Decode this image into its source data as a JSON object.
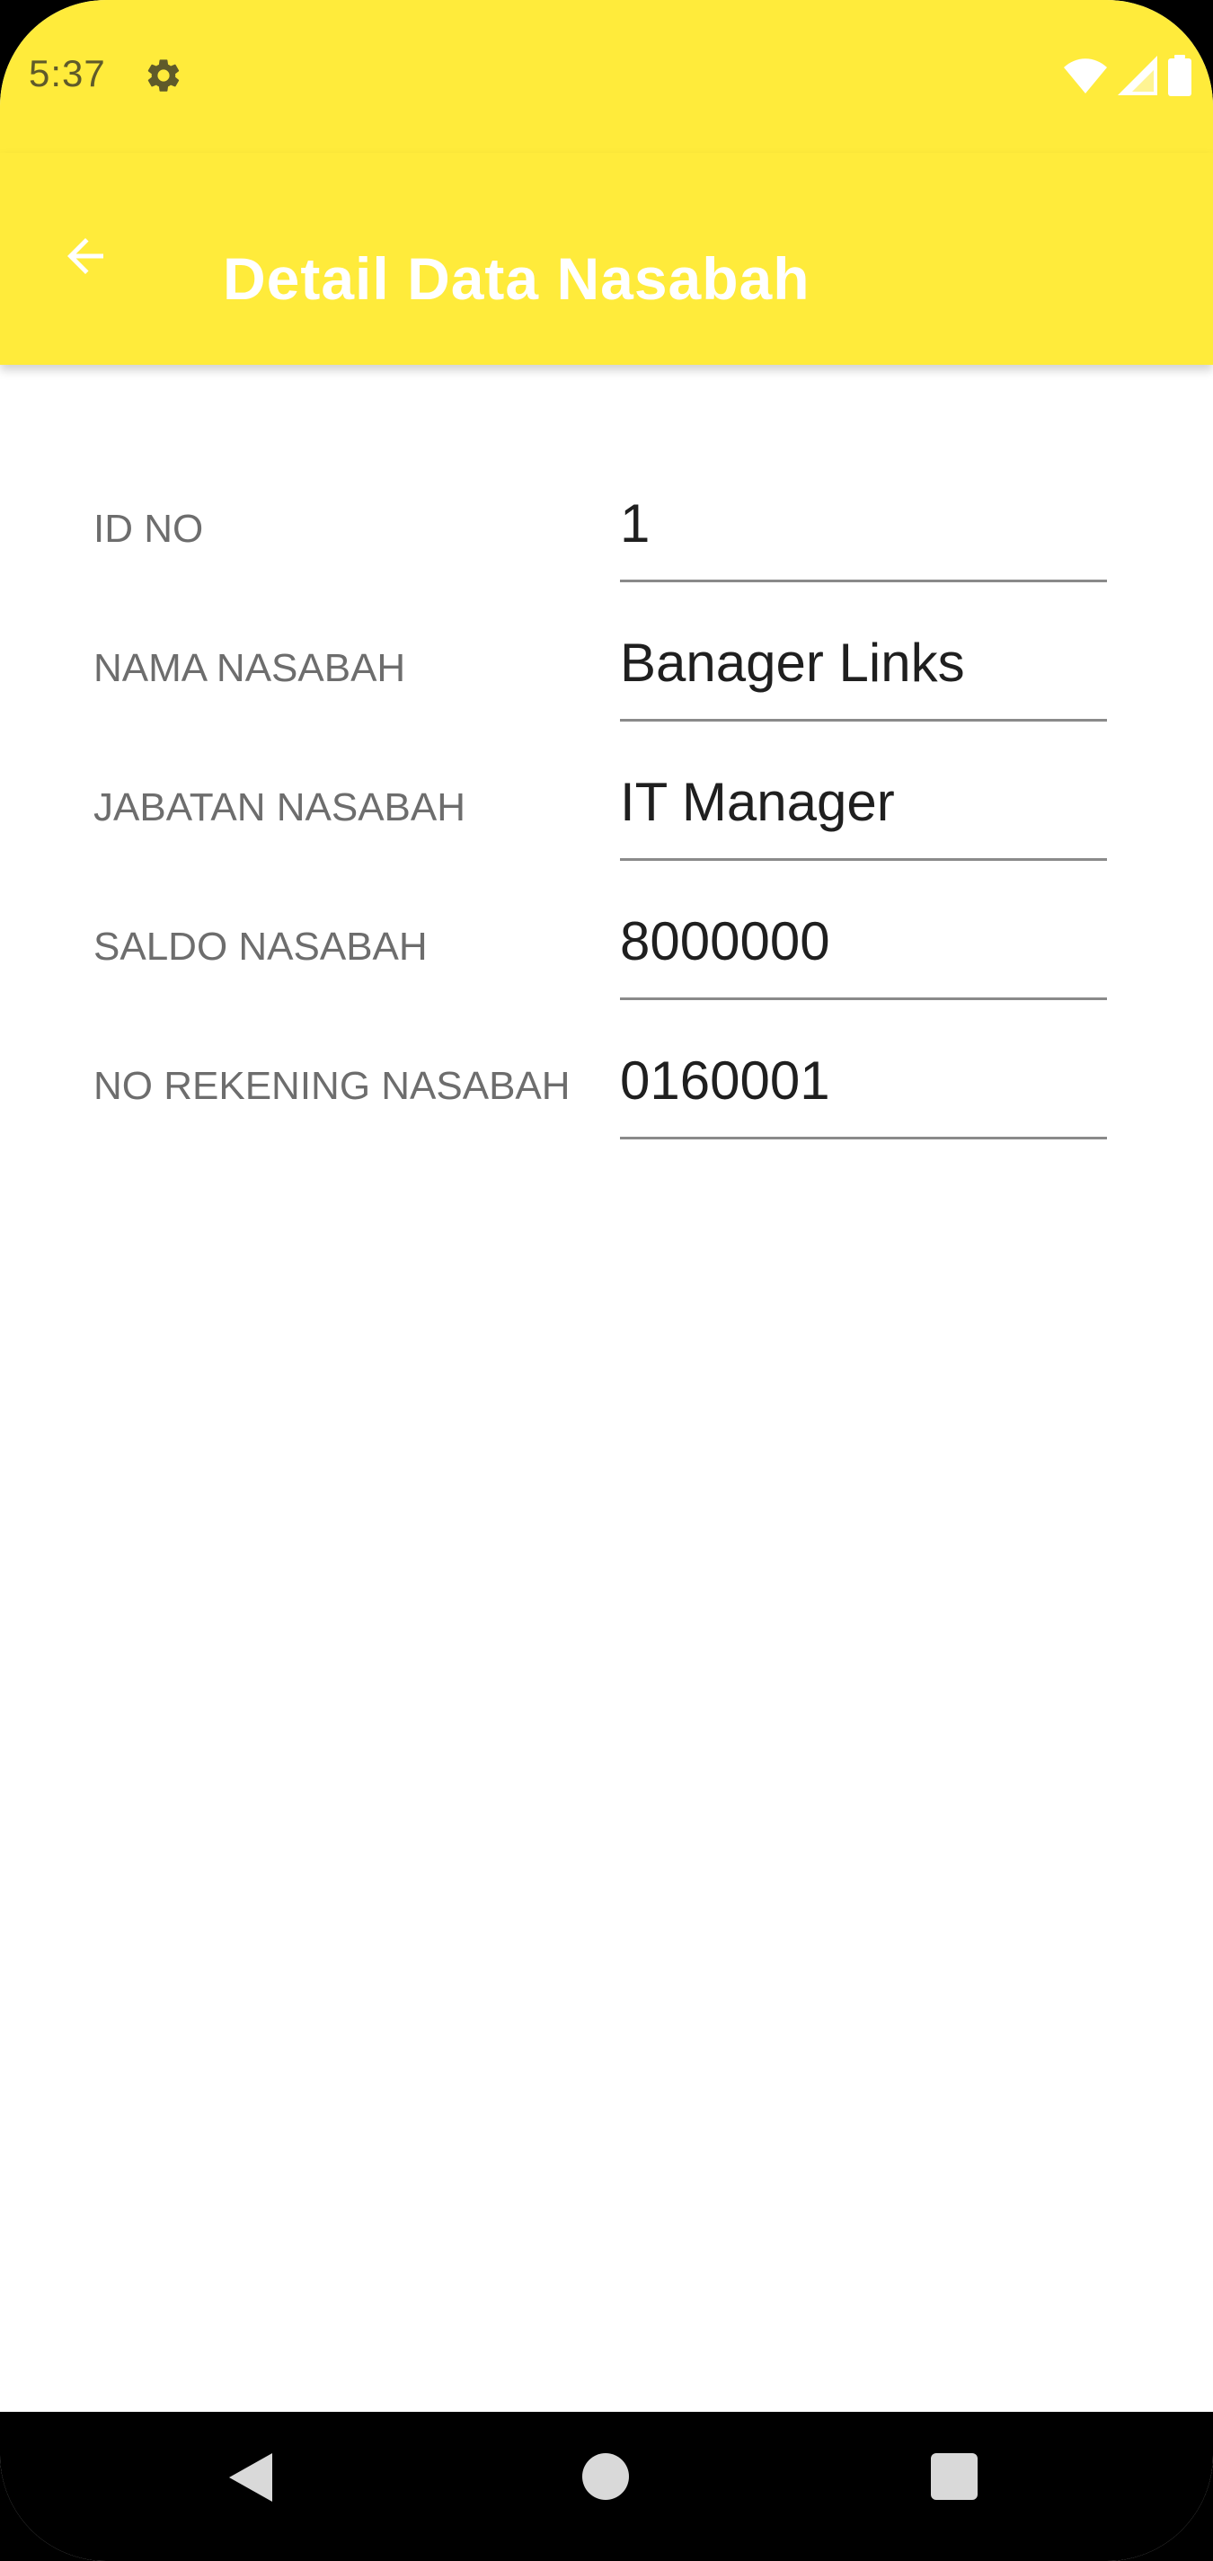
{
  "status_bar": {
    "time": "5:37",
    "icons": [
      "settings-gear-icon",
      "wifi-icon",
      "cellular-signal-icon",
      "battery-icon"
    ],
    "background_color": "#FFEB3B"
  },
  "app_bar": {
    "title": "Detail Data Nasabah",
    "back_icon": "arrow-back-icon",
    "background_color": "#FFEB3B",
    "title_color": "#FFFFFF"
  },
  "form": {
    "fields": [
      {
        "label": "ID NO",
        "value": "1"
      },
      {
        "label": "NAMA NASABAH",
        "value": "Banager Links"
      },
      {
        "label": "JABATAN NASABAH",
        "value": "IT Manager"
      },
      {
        "label": "SALDO NASABAH",
        "value": "8000000"
      },
      {
        "label": "NO REKENING NASABAH",
        "value": "0160001"
      }
    ]
  },
  "nav_bar": {
    "buttons": [
      "nav-back-icon",
      "nav-home-icon",
      "nav-recents-icon"
    ]
  }
}
